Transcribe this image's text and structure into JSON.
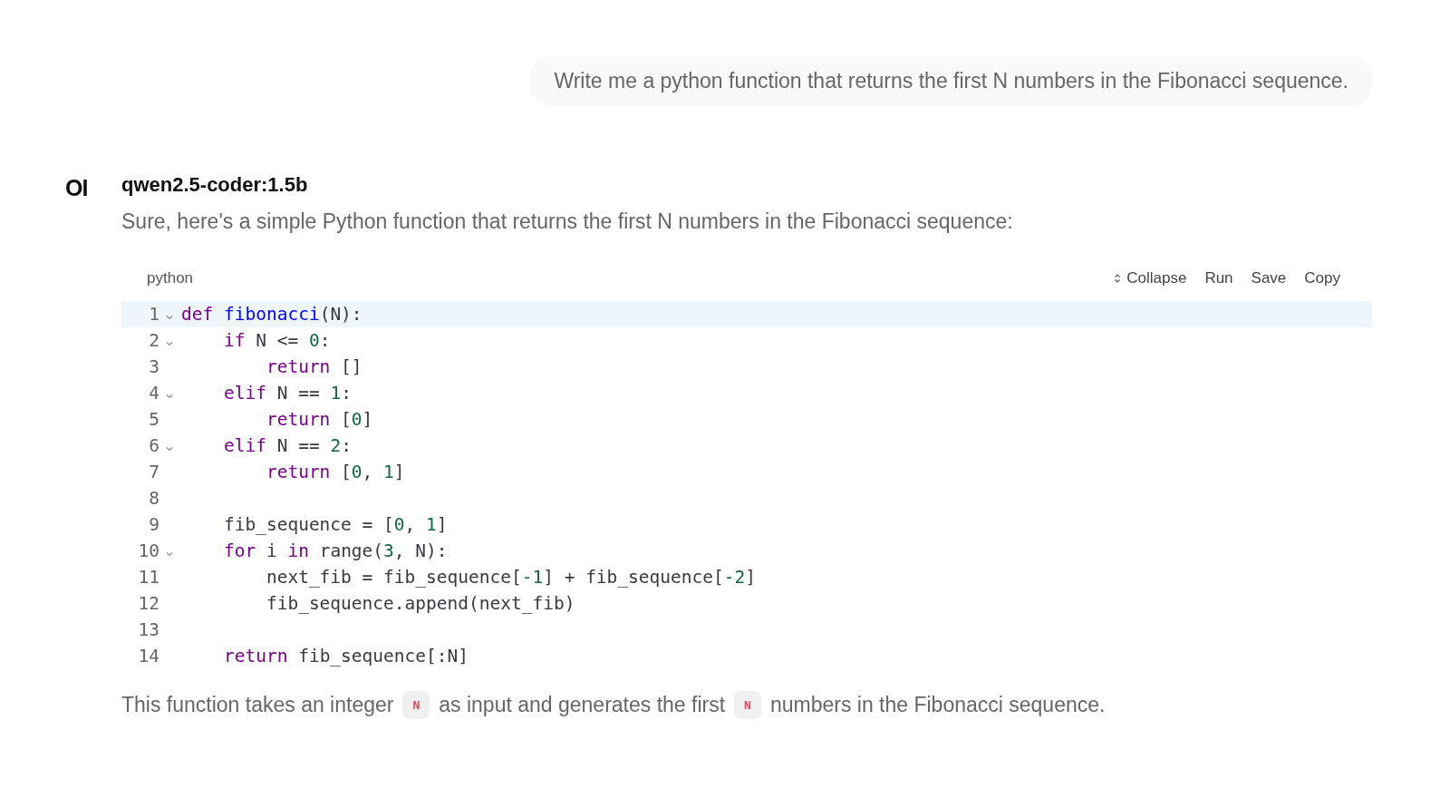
{
  "user_message": "Write me a python function that returns the first N numbers in the Fibonacci sequence.",
  "assistant": {
    "logo": "OI",
    "model": "qwen2.5-coder:1.5b",
    "intro": "Sure, here's a simple Python function that returns the first N numbers in the Fibonacci sequence:"
  },
  "code_block": {
    "language": "python",
    "actions": [
      {
        "label": "Collapse",
        "kind": "collapse"
      },
      {
        "label": "Run",
        "kind": "plain"
      },
      {
        "label": "Save",
        "kind": "plain"
      },
      {
        "label": "Copy",
        "kind": "plain"
      }
    ],
    "lines": [
      {
        "number": "1",
        "foldable": true,
        "active": true,
        "tokens": [
          {
            "text": "def",
            "kind": "keyword"
          },
          {
            "text": " fibonacci",
            "kind": "def"
          },
          {
            "text": "(N):",
            "kind": "plain"
          }
        ]
      },
      {
        "number": "2",
        "foldable": true,
        "active": false,
        "tokens": [
          {
            "text": "    if",
            "kind": "keyword"
          },
          {
            "text": " N <= ",
            "kind": "plain"
          },
          {
            "text": "0",
            "kind": "number"
          },
          {
            "text": ":",
            "kind": "plain"
          }
        ]
      },
      {
        "number": "3",
        "foldable": false,
        "active": false,
        "tokens": [
          {
            "text": "        return",
            "kind": "keyword"
          },
          {
            "text": " []",
            "kind": "plain"
          }
        ]
      },
      {
        "number": "4",
        "foldable": true,
        "active": false,
        "tokens": [
          {
            "text": "    elif",
            "kind": "keyword"
          },
          {
            "text": " N == ",
            "kind": "plain"
          },
          {
            "text": "1",
            "kind": "number"
          },
          {
            "text": ":",
            "kind": "plain"
          }
        ]
      },
      {
        "number": "5",
        "foldable": false,
        "active": false,
        "tokens": [
          {
            "text": "        return",
            "kind": "keyword"
          },
          {
            "text": " [",
            "kind": "plain"
          },
          {
            "text": "0",
            "kind": "number"
          },
          {
            "text": "]",
            "kind": "plain"
          }
        ]
      },
      {
        "number": "6",
        "foldable": true,
        "active": false,
        "tokens": [
          {
            "text": "    elif",
            "kind": "keyword"
          },
          {
            "text": " N == ",
            "kind": "plain"
          },
          {
            "text": "2",
            "kind": "number"
          },
          {
            "text": ":",
            "kind": "plain"
          }
        ]
      },
      {
        "number": "7",
        "foldable": false,
        "active": false,
        "tokens": [
          {
            "text": "        return",
            "kind": "keyword"
          },
          {
            "text": " [",
            "kind": "plain"
          },
          {
            "text": "0",
            "kind": "number"
          },
          {
            "text": ", ",
            "kind": "plain"
          },
          {
            "text": "1",
            "kind": "number"
          },
          {
            "text": "]",
            "kind": "plain"
          }
        ]
      },
      {
        "number": "8",
        "foldable": false,
        "active": false
      },
      {
        "number": "9",
        "foldable": false,
        "active": false,
        "tokens": [
          {
            "text": "    fib_sequence = [",
            "kind": "plain"
          },
          {
            "text": "0",
            "kind": "number"
          },
          {
            "text": ", ",
            "kind": "plain"
          },
          {
            "text": "1",
            "kind": "number"
          },
          {
            "text": "]",
            "kind": "plain"
          }
        ]
      },
      {
        "number": "10",
        "foldable": true,
        "active": false,
        "tokens": [
          {
            "text": "    for",
            "kind": "keyword"
          },
          {
            "text": " i ",
            "kind": "plain"
          },
          {
            "text": "in",
            "kind": "keyword"
          },
          {
            "text": " range(",
            "kind": "plain"
          },
          {
            "text": "3",
            "kind": "number"
          },
          {
            "text": ", N):",
            "kind": "plain"
          }
        ]
      },
      {
        "number": "11",
        "foldable": false,
        "active": false,
        "tokens": [
          {
            "text": "        next_fib = fib_sequence[",
            "kind": "plain"
          },
          {
            "text": "-1",
            "kind": "number"
          },
          {
            "text": "] + fib_sequence[",
            "kind": "plain"
          },
          {
            "text": "-2",
            "kind": "number"
          },
          {
            "text": "]",
            "kind": "plain"
          }
        ]
      },
      {
        "number": "12",
        "foldable": false,
        "active": false,
        "tokens": [
          {
            "text": "        fib_sequence.append(next_fib)",
            "kind": "plain"
          }
        ]
      },
      {
        "number": "13",
        "foldable": false,
        "active": false
      },
      {
        "number": "14",
        "foldable": false,
        "active": false,
        "tokens": [
          {
            "text": "    return",
            "kind": "keyword"
          },
          {
            "text": " fib_sequence[:N]",
            "kind": "plain"
          }
        ]
      }
    ]
  },
  "outro": [
    {
      "text": "This function takes an integer",
      "kind": "text"
    },
    {
      "text": "N",
      "kind": "code"
    },
    {
      "text": "as input and generates the first",
      "kind": "text"
    },
    {
      "text": "N",
      "kind": "code"
    },
    {
      "text": "numbers in the Fibonacci sequence.",
      "kind": "text"
    }
  ]
}
